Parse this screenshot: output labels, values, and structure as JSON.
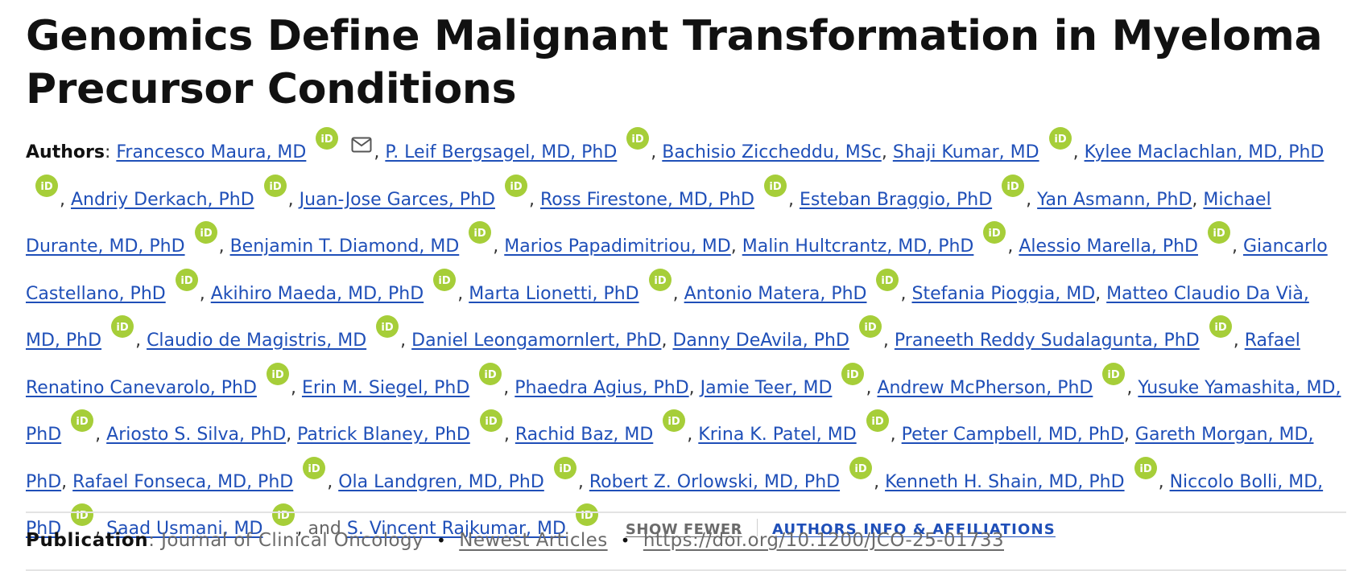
{
  "article": {
    "title": "Genomics Define Malignant Transformation in Myeloma Precursor Conditions"
  },
  "authors": {
    "label": "Authors",
    "label_colon": ": ",
    "list": [
      {
        "name": "Francesco Maura, MD",
        "orcid": true,
        "email": true
      },
      {
        "name": "P. Leif Bergsagel, MD, PhD",
        "orcid": true
      },
      {
        "name": "Bachisio Ziccheddu, MSc",
        "orcid": false
      },
      {
        "name": "Shaji Kumar, MD",
        "orcid": true
      },
      {
        "name": "Kylee Maclachlan, MD, PhD",
        "orcid": true
      },
      {
        "name": "Andriy Derkach, PhD",
        "orcid": true
      },
      {
        "name": "Juan-Jose Garces, PhD",
        "orcid": true
      },
      {
        "name": "Ross Firestone, MD, PhD",
        "orcid": true
      },
      {
        "name": "Esteban Braggio, PhD",
        "orcid": true
      },
      {
        "name": "Yan Asmann, PhD",
        "orcid": false
      },
      {
        "name": "Michael Durante, MD, PhD",
        "orcid": true
      },
      {
        "name": "Benjamin T. Diamond, MD",
        "orcid": true
      },
      {
        "name": "Marios Papadimitriou, MD",
        "orcid": false
      },
      {
        "name": "Malin Hultcrantz, MD, PhD",
        "orcid": true
      },
      {
        "name": "Alessio Marella, PhD",
        "orcid": true
      },
      {
        "name": "Giancarlo Castellano, PhD",
        "orcid": true
      },
      {
        "name": "Akihiro Maeda, MD, PhD",
        "orcid": true
      },
      {
        "name": "Marta Lionetti, PhD",
        "orcid": true
      },
      {
        "name": "Antonio Matera, PhD",
        "orcid": true
      },
      {
        "name": "Stefania Pioggia, MD",
        "orcid": false
      },
      {
        "name": "Matteo Claudio Da Vià, MD, PhD",
        "orcid": true
      },
      {
        "name": "Claudio de Magistris, MD",
        "orcid": true
      },
      {
        "name": "Daniel Leongamornlert, PhD",
        "orcid": false
      },
      {
        "name": "Danny DeAvila, PhD",
        "orcid": true
      },
      {
        "name": "Praneeth Reddy Sudalagunta, PhD",
        "orcid": true
      },
      {
        "name": "Rafael Renatino Canevarolo, PhD",
        "orcid": true
      },
      {
        "name": "Erin M. Siegel, PhD",
        "orcid": true
      },
      {
        "name": "Phaedra Agius, PhD",
        "orcid": false
      },
      {
        "name": "Jamie Teer, MD",
        "orcid": true
      },
      {
        "name": "Andrew McPherson, PhD",
        "orcid": true
      },
      {
        "name": "Yusuke Yamashita, MD, PhD",
        "orcid": true
      },
      {
        "name": "Ariosto S. Silva, PhD",
        "orcid": false
      },
      {
        "name": "Patrick Blaney, PhD",
        "orcid": true
      },
      {
        "name": "Rachid Baz, MD",
        "orcid": true
      },
      {
        "name": "Krina K. Patel, MD",
        "orcid": true
      },
      {
        "name": "Peter Campbell, MD, PhD",
        "orcid": false
      },
      {
        "name": "Gareth Morgan, MD, PhD",
        "orcid": false
      },
      {
        "name": "Rafael Fonseca, MD, PhD",
        "orcid": true
      },
      {
        "name": "Ola Landgren, MD, PhD",
        "orcid": true
      },
      {
        "name": "Robert Z. Orlowski, MD, PhD",
        "orcid": true
      },
      {
        "name": "Kenneth H. Shain, MD, PhD",
        "orcid": true
      },
      {
        "name": "Niccolo Bolli, MD, PhD",
        "orcid": true
      },
      {
        "name": "Saad Usmani, MD",
        "orcid": true
      },
      {
        "name": "S. Vincent Rajkumar, MD",
        "orcid": true
      }
    ],
    "separator": ", ",
    "and_word": "and",
    "show_fewer_label": "SHOW FEWER",
    "affiliations_label": "AUTHORS INFO & AFFILIATIONS"
  },
  "icons": {
    "orcid": "orcid-icon",
    "email": "mail-icon",
    "orcid_color": "#a6ce39",
    "link_color": "#1f4fb8"
  },
  "publication": {
    "label": "Publication",
    "label_colon": ": ",
    "journal": "Journal of Clinical Oncology",
    "bullet": "•",
    "section": "Newest Articles",
    "doi": "https://doi.org/10.1200/JCO-25-01733"
  }
}
